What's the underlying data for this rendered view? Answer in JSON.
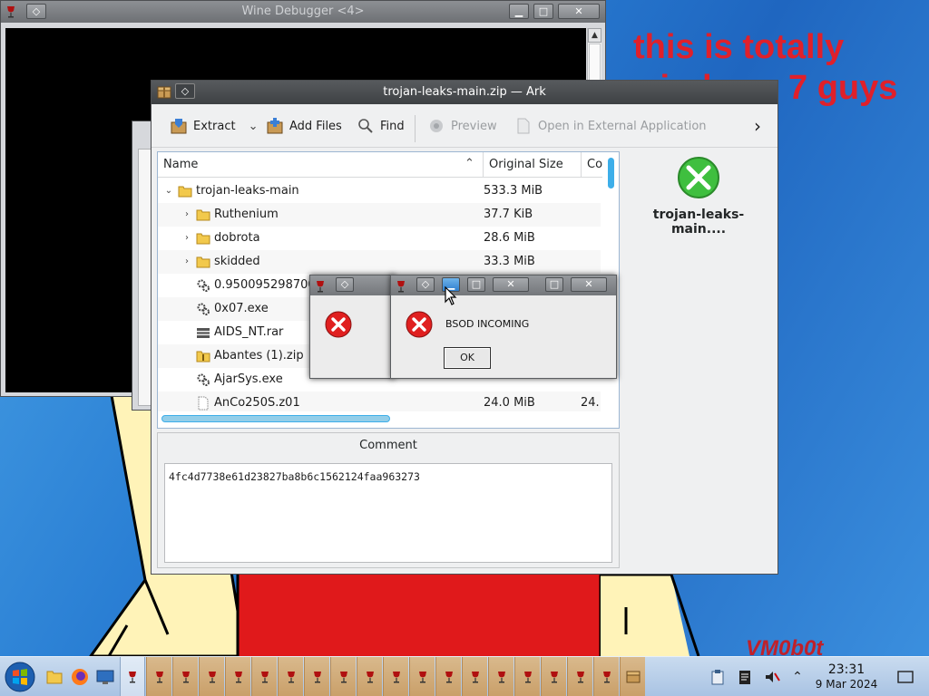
{
  "desktop": {
    "speech_text": "this is totally windows 7 guys",
    "vm_logo": "VM0b0t"
  },
  "debugger": {
    "title": "Wine Debugger <4>",
    "buttons": {
      "shade": "◇",
      "minimize": "▁",
      "maximize": "□",
      "close": "✕"
    }
  },
  "ark": {
    "title": "trojan-leaks-main.zip — Ark",
    "toolbar": {
      "extract": "Extract",
      "add_files": "Add Files",
      "find": "Find",
      "preview": "Preview",
      "open_external": "Open in External Application",
      "more": "›"
    },
    "columns": {
      "name": "Name",
      "original_size": "Original Size",
      "compressed": "Co"
    },
    "rows": [
      {
        "name": "trojan-leaks-main",
        "size": "533.3 MiB",
        "type": "folder",
        "expand": "⌄"
      },
      {
        "name": "Ruthenium",
        "size": "37.7 KiB",
        "type": "folder",
        "expand": "›"
      },
      {
        "name": "dobrota",
        "size": "28.6 MiB",
        "type": "folder",
        "expand": "›"
      },
      {
        "name": "skidded",
        "size": "33.3 MiB",
        "type": "folder",
        "expand": "›"
      },
      {
        "name": "0.9500952987006",
        "size": "",
        "type": "exe"
      },
      {
        "name": "0x07.exe",
        "size": "",
        "type": "exe"
      },
      {
        "name": "AIDS_NT.rar",
        "size": "",
        "type": "rar"
      },
      {
        "name": "Abantes (1).zip",
        "size": "",
        "type": "zip"
      },
      {
        "name": "AjarSys.exe",
        "size": "",
        "type": "exe"
      },
      {
        "name": "AnCo250S.z01",
        "size": "24.0 MiB",
        "compressed": "24.",
        "type": "file"
      }
    ],
    "selected_name": "trojan-leaks-main....",
    "comment_label": "Comment",
    "comment": "4fc4d7738e61d23827ba8b6c1562124faa963273"
  },
  "dialog": {
    "message": "BSOD INCOMING",
    "ok_label": "OK"
  },
  "taskbar": {
    "time": "23:31",
    "date": "9 Mar 2024"
  },
  "colors": {
    "error_red": "#e02020",
    "kde_blue": "#3daee9",
    "caption_text": "#e0202a"
  }
}
